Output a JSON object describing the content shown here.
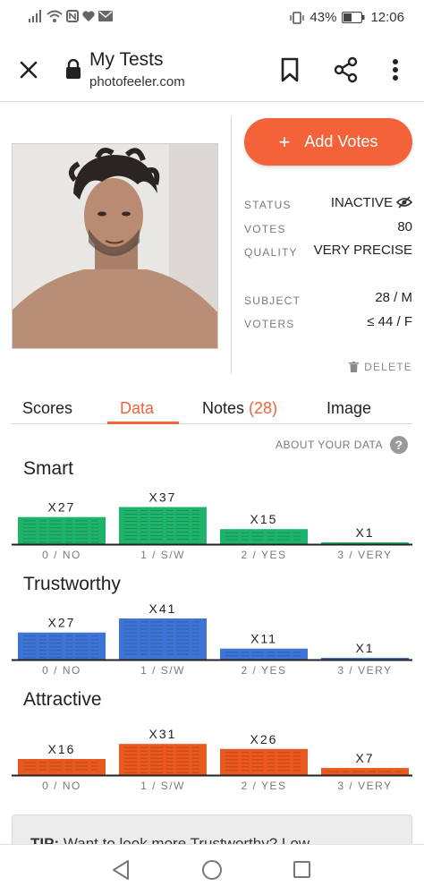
{
  "status_bar": {
    "battery": "43%",
    "time": "12:06"
  },
  "app_bar": {
    "title": "My Tests",
    "subtitle": "photofeeler.com"
  },
  "actions": {
    "add_votes": "Add Votes"
  },
  "info": [
    {
      "label": "STATUS",
      "value": "INACTIVE"
    },
    {
      "label": "VOTES",
      "value": "80"
    },
    {
      "label": "QUALITY",
      "value": "VERY PRECISE"
    },
    {
      "label": "SUBJECT",
      "value": "28 / M"
    },
    {
      "label": "VOTERS",
      "value": "≤ 44 / F"
    }
  ],
  "delete_label": "DELETE",
  "tabs": {
    "scores": "Scores",
    "data": "Data",
    "notes": "Notes",
    "notes_count": "(28)",
    "image": "Image"
  },
  "about_label": "ABOUT YOUR DATA",
  "charts": [
    {
      "title": "Smart",
      "color": "#1db36a",
      "categories": [
        "0 / NO",
        "1 / S/W",
        "2 / YES",
        "3 / VERY"
      ],
      "values": [
        27,
        37,
        15,
        1
      ],
      "labels": [
        "X27",
        "X37",
        "X15",
        "X1"
      ]
    },
    {
      "title": "Trustworthy",
      "color": "#3d74d6",
      "categories": [
        "0 / NO",
        "1 / S/W",
        "2 / YES",
        "3 / VERY"
      ],
      "values": [
        27,
        41,
        11,
        1
      ],
      "labels": [
        "X27",
        "X41",
        "X11",
        "X1"
      ]
    },
    {
      "title": "Attractive",
      "color": "#e9581e",
      "categories": [
        "0 / NO",
        "1 / S/W",
        "2 / YES",
        "3 / VERY"
      ],
      "values": [
        16,
        31,
        26,
        7
      ],
      "labels": [
        "X16",
        "X31",
        "X26",
        "X7"
      ]
    }
  ],
  "tip": {
    "prefix": "TIP:",
    "text": "Want to look more Trustworthy? Low"
  }
}
